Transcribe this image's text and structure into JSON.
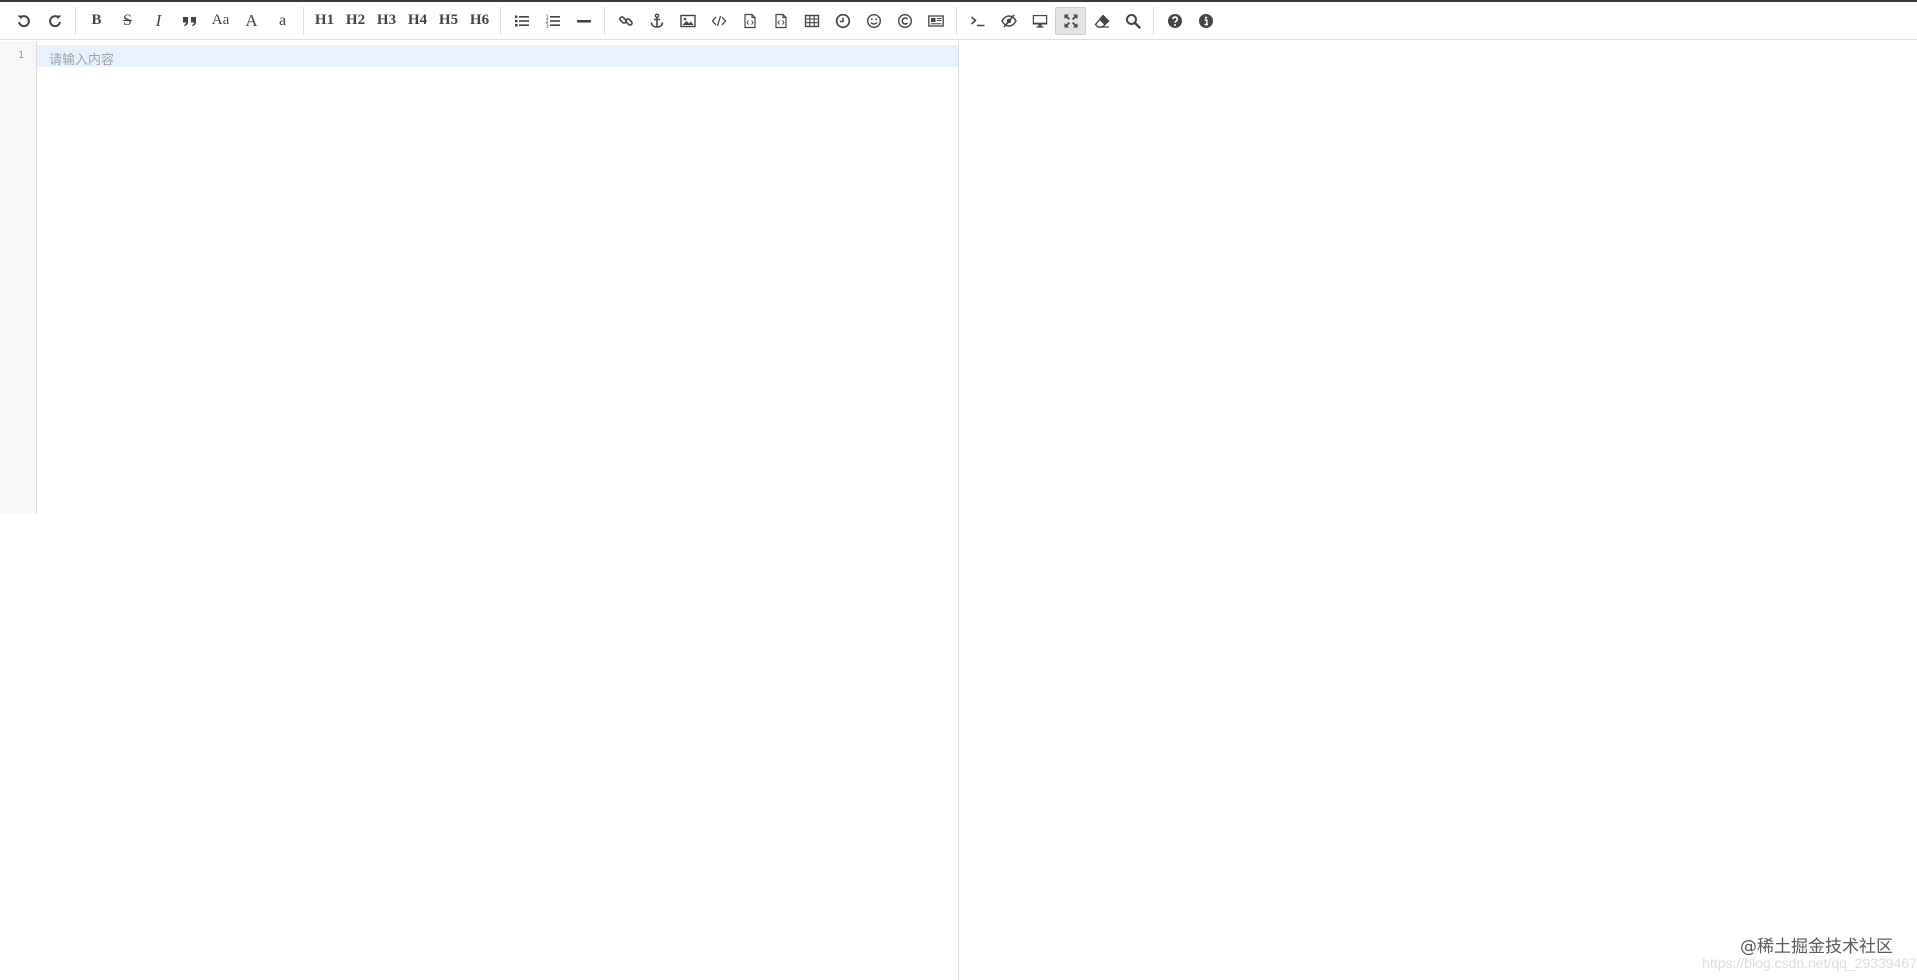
{
  "toolbar": {
    "groups": [
      [
        {
          "name": "undo-icon",
          "type": "icon",
          "icon": "undo"
        },
        {
          "name": "redo-icon",
          "type": "icon",
          "icon": "redo"
        }
      ],
      [
        {
          "name": "bold-button",
          "type": "text",
          "text": "B",
          "style": "bold"
        },
        {
          "name": "strikethrough-button",
          "type": "text",
          "text": "S",
          "style": "strike"
        },
        {
          "name": "italic-button",
          "type": "text",
          "text": "I",
          "style": "italic"
        },
        {
          "name": "quote-icon",
          "type": "icon",
          "icon": "quote"
        },
        {
          "name": "uppercase-button",
          "type": "text",
          "text": "Aa",
          "style": "normal"
        },
        {
          "name": "uppercase-all-button",
          "type": "text",
          "text": "A",
          "style": "big"
        },
        {
          "name": "lowercase-button",
          "type": "text",
          "text": "a",
          "style": "small"
        }
      ],
      [
        {
          "name": "h1-button",
          "type": "text",
          "text": "H1",
          "style": "bold"
        },
        {
          "name": "h2-button",
          "type": "text",
          "text": "H2",
          "style": "bold"
        },
        {
          "name": "h3-button",
          "type": "text",
          "text": "H3",
          "style": "bold"
        },
        {
          "name": "h4-button",
          "type": "text",
          "text": "H4",
          "style": "bold"
        },
        {
          "name": "h5-button",
          "type": "text",
          "text": "H5",
          "style": "bold"
        },
        {
          "name": "h6-button",
          "type": "text",
          "text": "H6",
          "style": "bold"
        }
      ],
      [
        {
          "name": "unordered-list-icon",
          "type": "icon",
          "icon": "list-ul"
        },
        {
          "name": "ordered-list-icon",
          "type": "icon",
          "icon": "list-ol"
        },
        {
          "name": "horizontal-rule-icon",
          "type": "icon",
          "icon": "hr"
        }
      ],
      [
        {
          "name": "link-icon",
          "type": "icon",
          "icon": "link"
        },
        {
          "name": "anchor-icon",
          "type": "icon",
          "icon": "anchor"
        },
        {
          "name": "image-icon",
          "type": "icon",
          "icon": "image"
        },
        {
          "name": "inline-code-icon",
          "type": "icon",
          "icon": "code"
        },
        {
          "name": "code-block-icon",
          "type": "icon",
          "icon": "file-code"
        },
        {
          "name": "preformatted-text-icon",
          "type": "icon",
          "icon": "file-code"
        },
        {
          "name": "table-icon",
          "type": "icon",
          "icon": "table"
        },
        {
          "name": "datetime-icon",
          "type": "icon",
          "icon": "clock"
        },
        {
          "name": "emoji-icon",
          "type": "icon",
          "icon": "smile"
        },
        {
          "name": "html-entities-icon",
          "type": "icon",
          "icon": "copyright"
        },
        {
          "name": "pagebreak-icon",
          "type": "icon",
          "icon": "newspaper"
        }
      ],
      [
        {
          "name": "goto-line-icon",
          "type": "icon",
          "icon": "terminal"
        },
        {
          "name": "toggle-preview-icon",
          "type": "icon",
          "icon": "eye-slash"
        },
        {
          "name": "html-preview-icon",
          "type": "icon",
          "icon": "desktop"
        },
        {
          "name": "fullscreen-icon",
          "type": "icon",
          "icon": "arrows",
          "active": true
        },
        {
          "name": "clear-icon",
          "type": "icon",
          "icon": "eraser"
        },
        {
          "name": "search-icon",
          "type": "icon",
          "icon": "search"
        }
      ],
      [
        {
          "name": "help-icon",
          "type": "icon",
          "icon": "question"
        },
        {
          "name": "info-icon",
          "type": "icon",
          "icon": "info"
        }
      ]
    ]
  },
  "editor": {
    "line_number": "1",
    "placeholder": "请输入内容"
  },
  "watermark": {
    "title": "@稀土掘金技术社区",
    "url": "https://blog.csdn.net/qq_29339467"
  }
}
